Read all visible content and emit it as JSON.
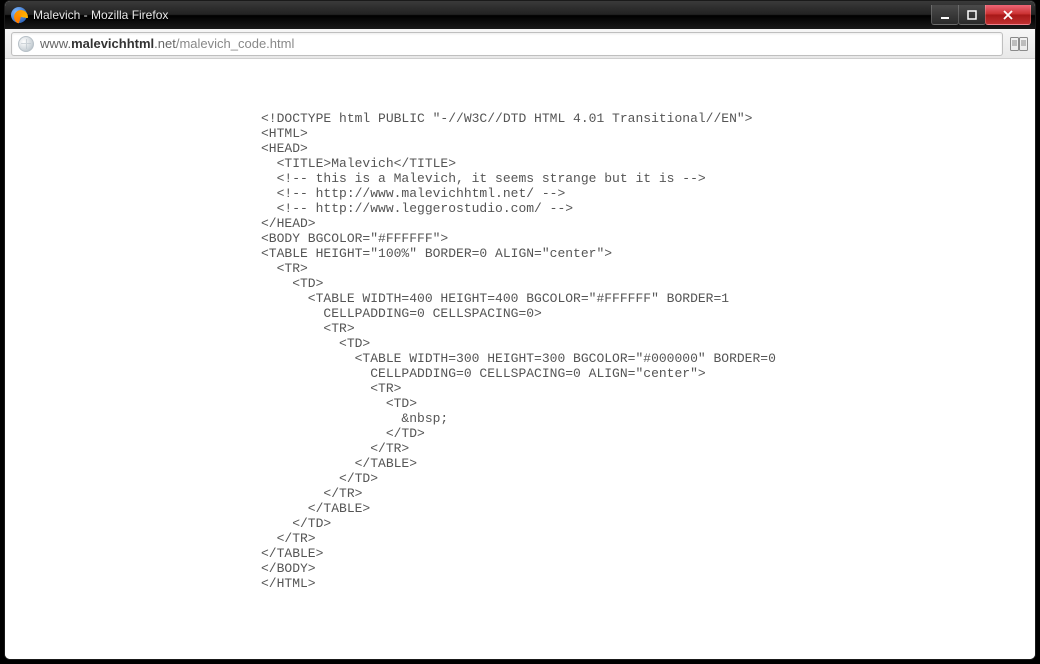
{
  "window": {
    "title": "Malevich - Mozilla Firefox"
  },
  "address": {
    "prefix": "www.",
    "bold": "malevichhtml",
    "suffix": ".net",
    "path": "/malevich_code.html"
  },
  "code": "<!DOCTYPE html PUBLIC \"-//W3C//DTD HTML 4.01 Transitional//EN\">\n<HTML>\n<HEAD>\n  <TITLE>Malevich</TITLE>\n  <!-- this is a Malevich, it seems strange but it is -->\n  <!-- http://www.malevichhtml.net/ -->\n  <!-- http://www.leggerostudio.com/ -->\n</HEAD>\n<BODY BGCOLOR=\"#FFFFFF\">\n<TABLE HEIGHT=\"100%\" BORDER=0 ALIGN=\"center\">\n  <TR>\n    <TD>\n      <TABLE WIDTH=400 HEIGHT=400 BGCOLOR=\"#FFFFFF\" BORDER=1\n        CELLPADDING=0 CELLSPACING=0>\n        <TR>\n          <TD>\n            <TABLE WIDTH=300 HEIGHT=300 BGCOLOR=\"#000000\" BORDER=0\n              CELLPADDING=0 CELLSPACING=0 ALIGN=\"center\">\n              <TR>\n                <TD>\n                  &nbsp;\n                </TD>\n              </TR>\n            </TABLE>\n          </TD>\n        </TR>\n      </TABLE>\n    </TD>\n  </TR>\n</TABLE>\n</BODY>\n</HTML>"
}
